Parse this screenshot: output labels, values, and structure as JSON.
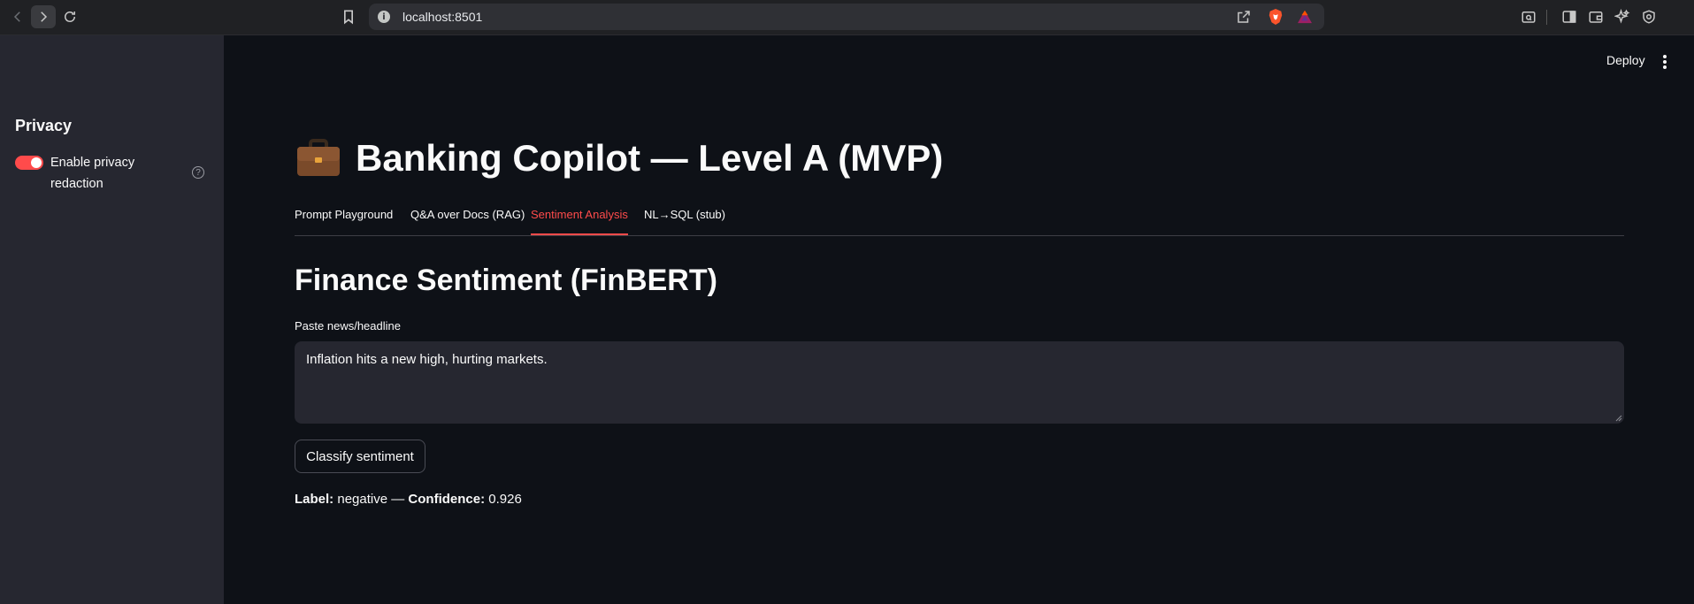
{
  "browser": {
    "url": "localhost:8501"
  },
  "sidebar": {
    "title": "Privacy",
    "toggle": {
      "label": "Enable privacy redaction",
      "enabled": true
    }
  },
  "header": {
    "deploy_label": "Deploy"
  },
  "main": {
    "title": "Banking Copilot — Level A (MVP)",
    "tabs": [
      {
        "label": "Prompt Playground",
        "active": false
      },
      {
        "label": "Q&A over Docs (RAG)",
        "active": false
      },
      {
        "label": "Sentiment Analysis",
        "active": true
      },
      {
        "label": "NL→SQL (stub)",
        "active": false
      }
    ],
    "section_title": "Finance Sentiment (FinBERT)",
    "input_label": "Paste news/headline",
    "input_value": "Inflation hits a new high, hurting markets.",
    "button_label": "Classify sentiment",
    "result": {
      "label_key": "Label:",
      "label_value": "negative",
      "separator": "—",
      "confidence_key": "Confidence:",
      "confidence_value": "0.926"
    }
  },
  "colors": {
    "accent": "#ff4b4b",
    "background": "#0e1117",
    "sidebar": "#262730"
  }
}
